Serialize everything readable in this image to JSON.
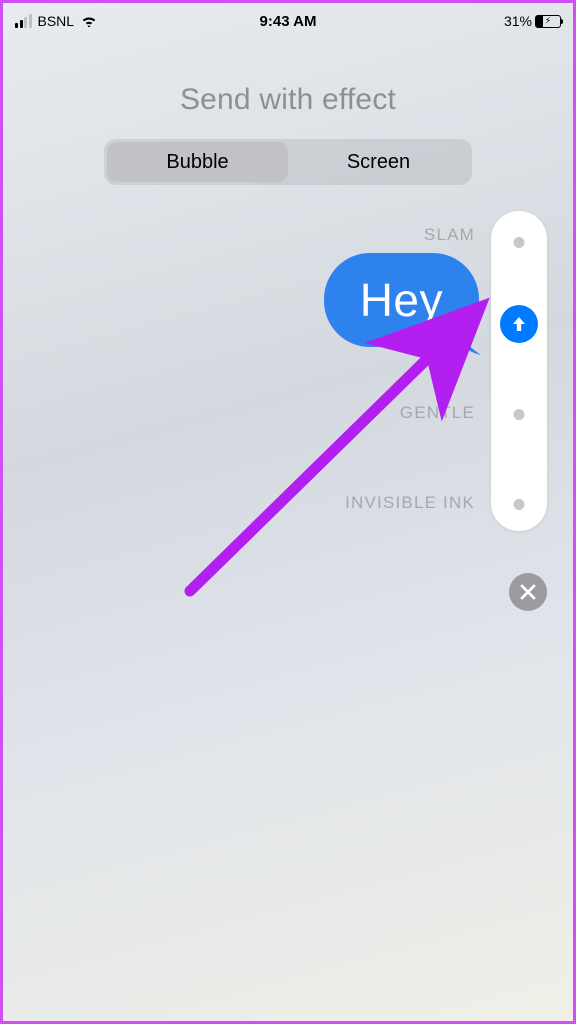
{
  "statusBar": {
    "carrier": "BSNL",
    "time": "9:43 AM",
    "batteryPercent": "31%"
  },
  "page": {
    "title": "Send with effect"
  },
  "segmented": {
    "tabs": [
      "Bubble",
      "Screen"
    ],
    "activeIndex": 0
  },
  "effects": {
    "slam": "SLAM",
    "gentle": "GENTLE",
    "invisible": "INVISIBLE INK"
  },
  "message": {
    "text": "Hey"
  },
  "colors": {
    "accent": "#007aff",
    "bubble": "#2d82ee",
    "annotation": "#b21ff0"
  }
}
